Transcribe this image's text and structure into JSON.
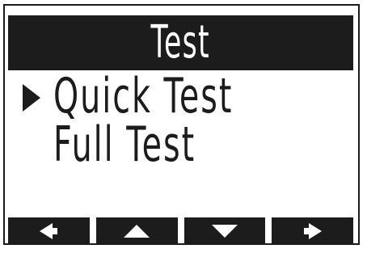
{
  "header": {
    "title": "Test"
  },
  "menu": {
    "selected_index": 0,
    "items": [
      {
        "label": "Quick Test"
      },
      {
        "label": "Full Test"
      }
    ]
  },
  "softkeys": [
    {
      "icon": "arrow-left-icon"
    },
    {
      "icon": "arrow-up-icon"
    },
    {
      "icon": "arrow-down-icon"
    },
    {
      "icon": "arrow-right-icon"
    }
  ],
  "colors": {
    "foreground": "#1c1c1c",
    "background": "#ffffff"
  }
}
